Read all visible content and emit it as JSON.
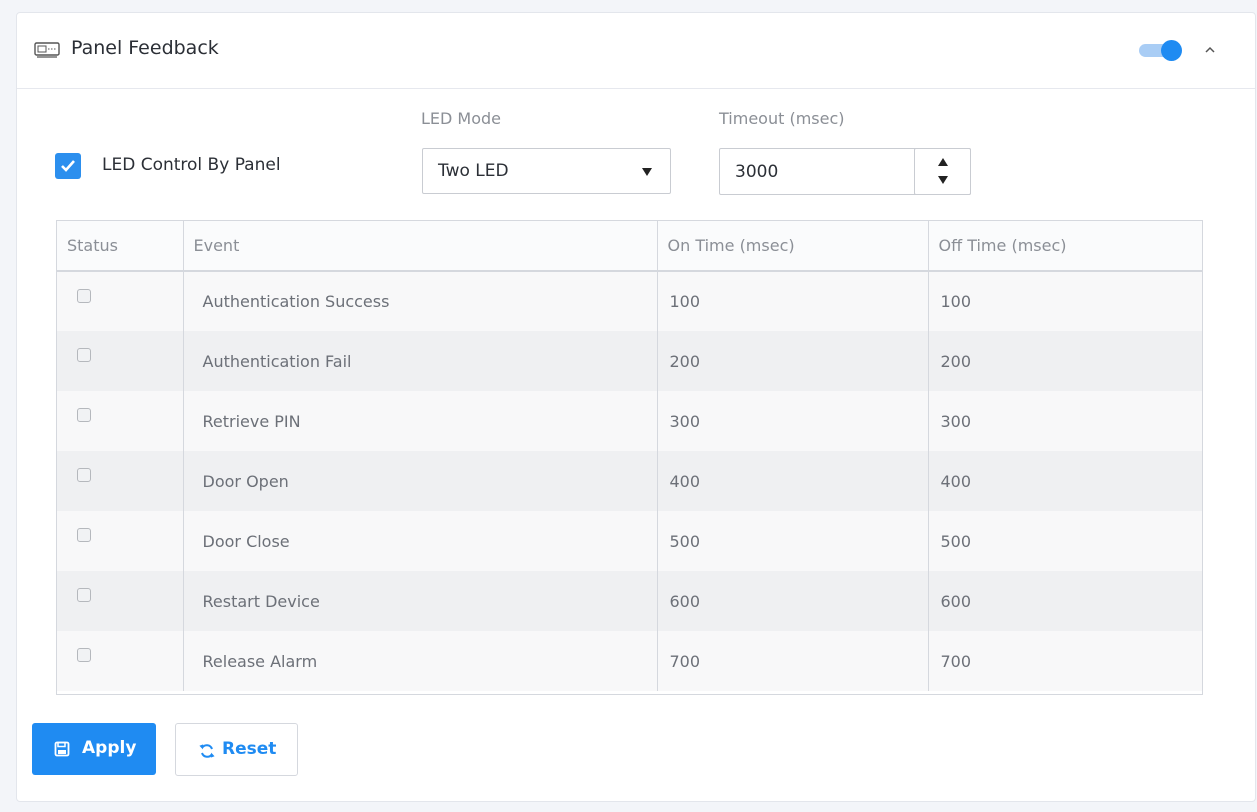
{
  "panel": {
    "title": "Panel Feedback",
    "icon": "keyboard-panel-icon",
    "toggle_on": true,
    "accent": "#1f8bf2"
  },
  "controls": {
    "led_control_label": "LED Control By Panel",
    "led_control_checked": true,
    "led_mode_label": "LED Mode",
    "led_mode_value": "Two LED",
    "timeout_label": "Timeout (msec)",
    "timeout_value": "3000"
  },
  "table": {
    "headers": [
      "Status",
      "Event",
      "On Time (msec)",
      "Off Time (msec)"
    ],
    "rows": [
      {
        "checked": false,
        "event": "Authentication Success",
        "on": "100",
        "off": "100"
      },
      {
        "checked": false,
        "event": "Authentication Fail",
        "on": "200",
        "off": "200"
      },
      {
        "checked": false,
        "event": "Retrieve PIN",
        "on": "300",
        "off": "300"
      },
      {
        "checked": false,
        "event": "Door Open",
        "on": "400",
        "off": "400"
      },
      {
        "checked": false,
        "event": "Door Close",
        "on": "500",
        "off": "500"
      },
      {
        "checked": false,
        "event": "Restart Device",
        "on": "600",
        "off": "600"
      },
      {
        "checked": false,
        "event": "Release Alarm",
        "on": "700",
        "off": "700"
      }
    ]
  },
  "actions": {
    "apply_label": "Apply",
    "reset_label": "Reset"
  }
}
